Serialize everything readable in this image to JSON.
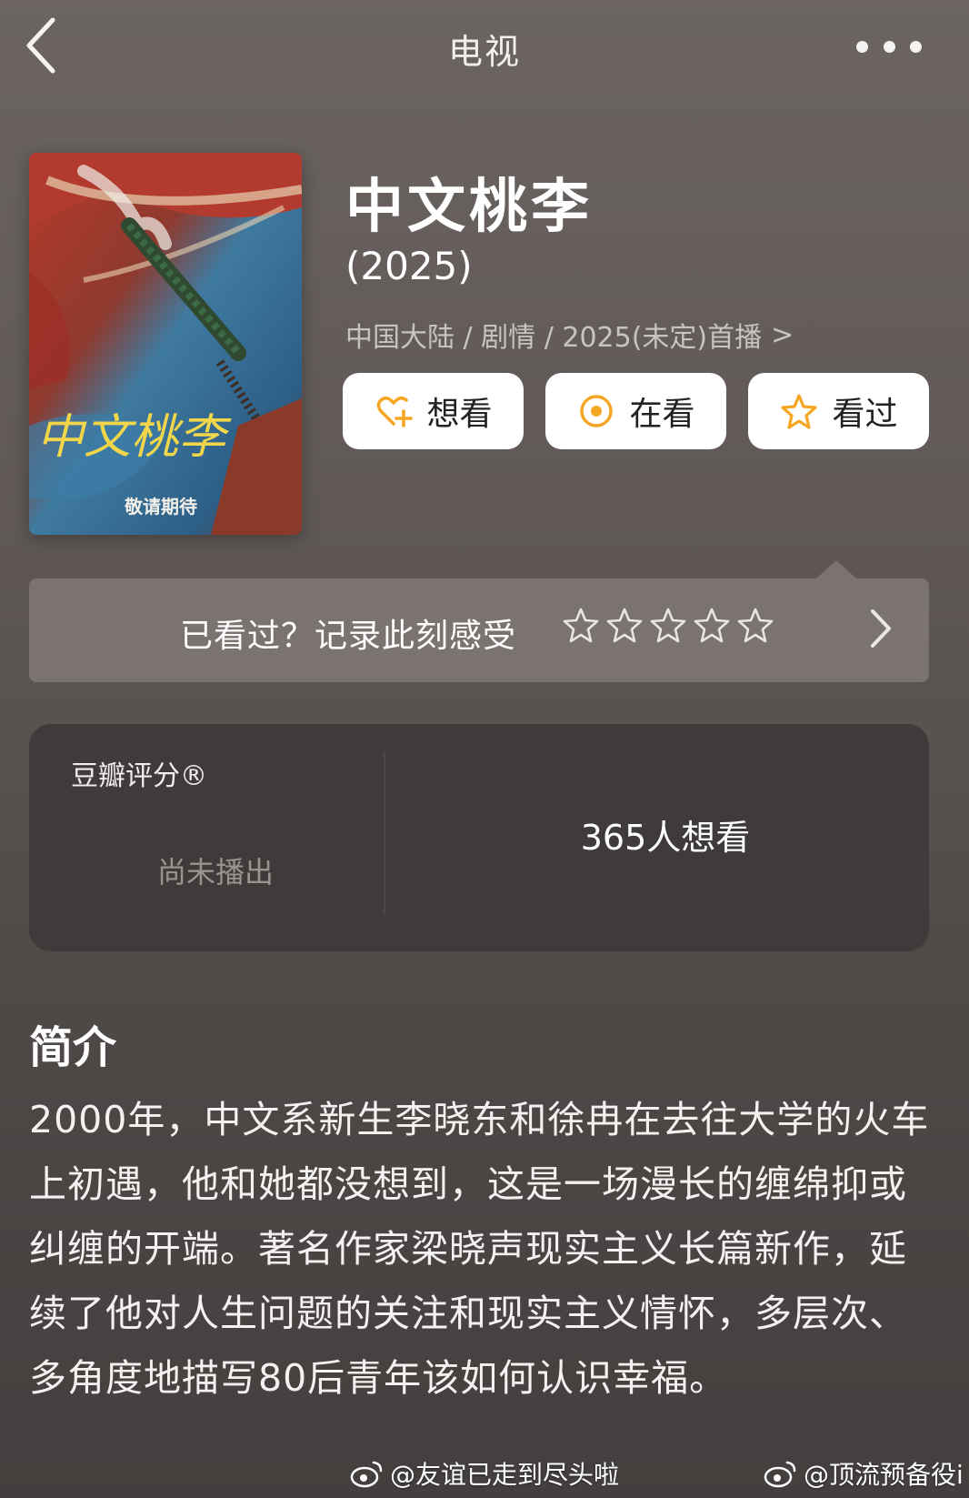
{
  "nav": {
    "title": "电视"
  },
  "poster": {
    "calligraphy": "中文桃李",
    "caption": "敬请期待"
  },
  "show": {
    "title": "中文桃李",
    "year": "(2025)",
    "meta": "中国大陆 / 剧情 / 2025(未定)首播",
    "meta_chevron": ">"
  },
  "actions": {
    "want": "想看",
    "watching": "在看",
    "watched": "看过"
  },
  "rating_prompt": {
    "text": "已看过？记录此刻感受",
    "stars": 5
  },
  "score": {
    "label": "豆瓣评分®",
    "status": "尚未播出",
    "wish_count": "365人想看"
  },
  "intro": {
    "heading": "简介",
    "body": "2000年，中文系新生李晓东和徐冉在去往大学的火车上初遇，他和她都没想到，这是一场漫长的缠绵抑或纠缠的开端。著名作家梁晓声现实主义长篇新作，延续了他对人生问题的关注和现实主义情怀，多层次、多角度地描写80后青年该如何认识幸福。"
  },
  "watermarks": {
    "left": "@友谊已走到尽头啦",
    "right": "@顶流预备役i"
  },
  "colors": {
    "accent": "#f5a623",
    "card_bg": "#3f3b3a",
    "prompt_bg": "#7a7370"
  }
}
